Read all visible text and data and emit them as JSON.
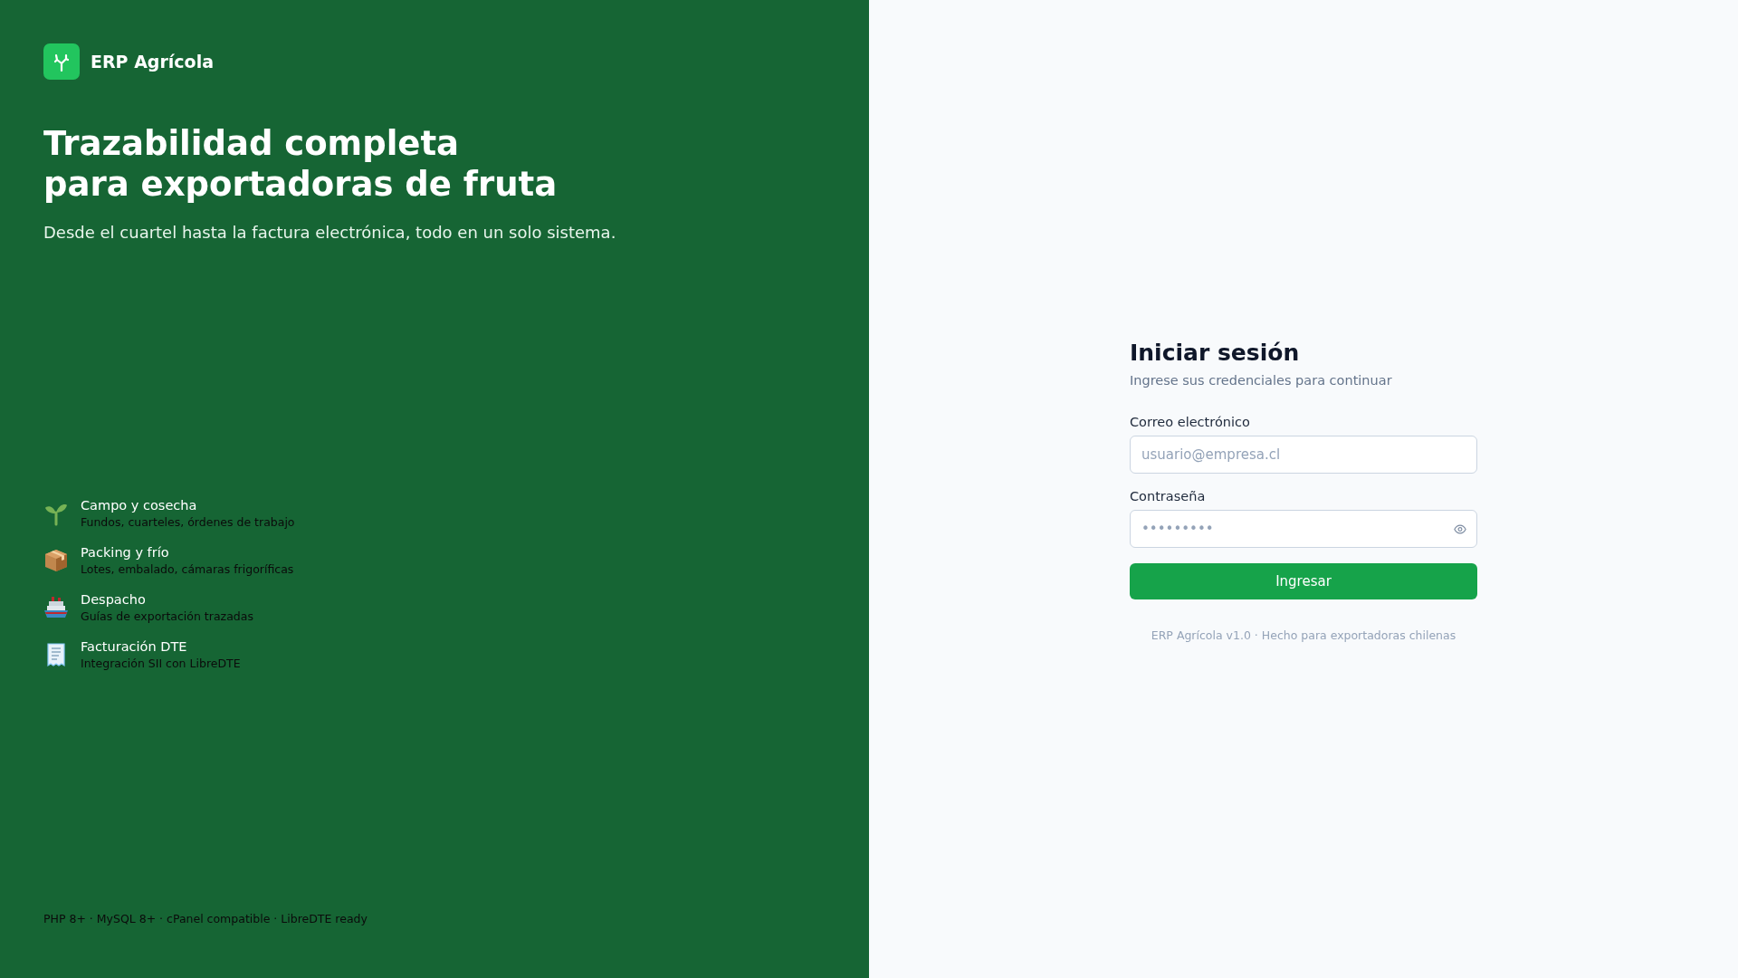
{
  "brand": {
    "name": "ERP Agrícola"
  },
  "hero": {
    "title_lines": [
      "Trazabilidad completa",
      "para exportadoras de fruta"
    ],
    "subtitle": "Desde el cuartel hasta la factura electrónica, todo en un solo sistema."
  },
  "features": [
    {
      "kind": "sprout",
      "title": "Campo y cosecha",
      "description": "Fundos, cuarteles, órdenes de trabajo"
    },
    {
      "kind": "box",
      "title": "Packing y frío",
      "description": "Lotes, embalado, cámaras frigoríficas"
    },
    {
      "kind": "ship",
      "title": "Despacho",
      "description": "Guías de exportación trazadas"
    },
    {
      "kind": "receipt",
      "title": "Facturación DTE",
      "description": "Integración SII con LibreDTE"
    }
  ],
  "tech_footer": "PHP 8+ · MySQL 8+ · cPanel compatible · LibreDTE ready",
  "login": {
    "title": "Iniciar sesión",
    "subtitle": "Ingrese sus credenciales para continuar",
    "email": {
      "label": "Correo electrónico",
      "placeholder": "usuario@empresa.cl"
    },
    "password": {
      "label": "Contraseña",
      "placeholder": "•••••••••"
    },
    "submit": "Ingresar",
    "footer": "ERP Agrícola v1.0 · Hecho para exportadoras chilenas"
  }
}
